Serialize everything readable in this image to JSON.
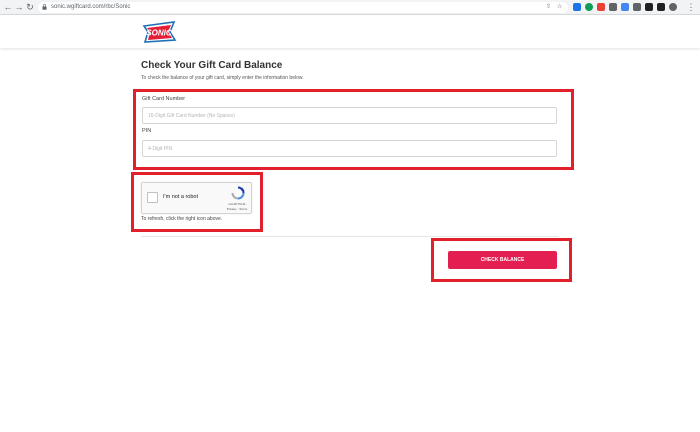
{
  "browser": {
    "url": "sonic.wgiftcard.com/rbc/Sonic",
    "nav_icons": [
      "back-arrow-icon",
      "forward-arrow-icon",
      "reload-icon"
    ],
    "omnibox_icons": [
      "share-icon",
      "star-icon"
    ],
    "extension_colors": [
      "#1a73e8",
      "#0f9d58",
      "#e94235",
      "#5f6368",
      "#4285f4",
      "#5f6368",
      "#202124",
      "#202124",
      "#5f6368"
    ]
  },
  "header": {
    "logo_alt": "SONIC"
  },
  "form": {
    "title": "Check Your Gift Card Balance",
    "subtitle": "To check the balance of your gift card, simply enter the information below.",
    "card_number_label": "Gift Card Number",
    "card_number_placeholder": "16-Digit Gift Card Number (No Spaces)",
    "pin_label": "PIN",
    "pin_placeholder": "4-Digit PIN"
  },
  "captcha": {
    "label": "I'm not a robot",
    "brand": "reCAPTCHA",
    "links": "Privacy - Terms",
    "refresh_note": "To refresh, click the right icon above."
  },
  "actions": {
    "check_balance_label": "CHECK BALANCE"
  },
  "colors": {
    "accent": "#e31f52",
    "highlight": "#e2202b",
    "logo_blue": "#1e6fb7",
    "logo_red": "#e31f38"
  }
}
